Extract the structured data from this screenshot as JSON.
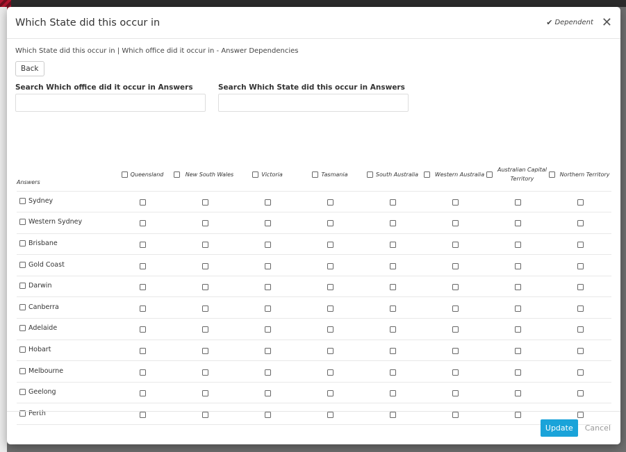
{
  "modal": {
    "title": "Which State did this occur in",
    "dependent_label": "Dependent",
    "breadcrumb": "Which State did this occur in | Which office did it occur in - Answer Dependencies",
    "back_label": "Back"
  },
  "search": {
    "office_label": "Search Which office did it occur in Answers",
    "office_value": "",
    "state_label": "Search Which State did this occur in Answers",
    "state_value": ""
  },
  "matrix": {
    "answers_header": "Answers",
    "columns": [
      "Queensland",
      "New South Wales",
      "Victoria",
      "Tasmania",
      "South Australia",
      "Western Australia",
      "Australian Capital Territory",
      "Northern Territory"
    ],
    "rows": [
      "Sydney",
      "Western Sydney",
      "Brisbane",
      "Gold Coast",
      "Darwin",
      "Canberra",
      "Adelaide",
      "Hobart",
      "Melbourne",
      "Geelong",
      "Perth"
    ]
  },
  "footer": {
    "update_label": "Update",
    "cancel_label": "Cancel"
  },
  "colors": {
    "primary": "#1aa3d9",
    "backdrop": "#6f6f6f"
  },
  "icons": {
    "dependent": "check-icon",
    "close": "close-icon"
  }
}
